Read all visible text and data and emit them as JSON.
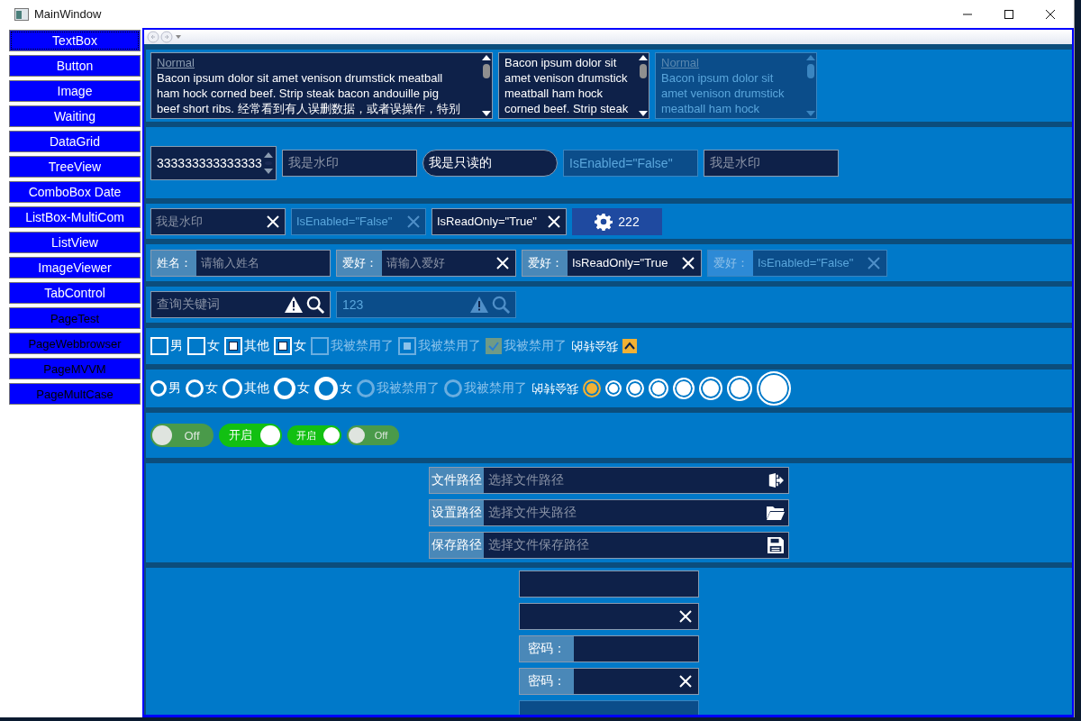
{
  "window": {
    "title": "MainWindow"
  },
  "nav_buttons": [
    {
      "label": "TextBox",
      "kind": "nav"
    },
    {
      "label": "Button",
      "kind": "nav"
    },
    {
      "label": "Image",
      "kind": "nav"
    },
    {
      "label": "Waiting",
      "kind": "nav"
    },
    {
      "label": "DataGrid",
      "kind": "nav"
    },
    {
      "label": "TreeView",
      "kind": "nav"
    },
    {
      "label": "ComboBox Date",
      "kind": "nav"
    },
    {
      "label": "ListBox-MultiCom",
      "kind": "nav"
    },
    {
      "label": "ListView",
      "kind": "nav"
    },
    {
      "label": "ImageViewer",
      "kind": "nav"
    },
    {
      "label": "TabControl",
      "kind": "nav"
    },
    {
      "label": "PageTest",
      "kind": "page"
    },
    {
      "label": "PageWebbrowser",
      "kind": "page"
    },
    {
      "label": "PageMVVM",
      "kind": "page"
    },
    {
      "label": "PageMultCase",
      "kind": "page"
    }
  ],
  "text_areas": [
    {
      "header": "Normal",
      "lines": [
        "Bacon ipsum dolor sit amet venison drumstick meatball",
        "ham hock corned beef. Strip steak bacon andouille pig",
        "beef short ribs. 经常看到有人误删数据，或者误操作，特别"
      ],
      "disabled": false
    },
    {
      "lines": [
        "Bacon ipsum dolor sit",
        "amet venison drumstick",
        "meatball ham hock",
        "corned beef. Strip steak"
      ],
      "disabled": false
    },
    {
      "header": "Normal",
      "lines": [
        "Bacon ipsum dolor sit",
        "amet venison drumstick",
        "meatball ham hock"
      ],
      "disabled": true
    }
  ],
  "input_row": [
    {
      "kind": "numeric",
      "value": "333333333333333",
      "disabled": false
    },
    {
      "kind": "text",
      "placeholder": "我是水印",
      "disabled": false
    },
    {
      "kind": "rounded",
      "value": "我是只读的",
      "disabled": false
    },
    {
      "kind": "text",
      "value": "IsEnabled=\"False\"",
      "disabled": true
    },
    {
      "kind": "text",
      "placeholder": "我是水印",
      "disabled": false
    }
  ],
  "clear_row": [
    {
      "placeholder": "我是水印",
      "disabled": false
    },
    {
      "value": "IsEnabled=\"False\"",
      "disabled": true
    },
    {
      "value": "IsReadOnly=\"True\"",
      "disabled": false
    }
  ],
  "gear_button": {
    "label": "222"
  },
  "labeled_row": [
    {
      "label": "姓名：",
      "placeholder": "请输入姓名",
      "clearable": false,
      "disabled": false
    },
    {
      "label": "爱好：",
      "placeholder": "请输入爱好",
      "clearable": true,
      "disabled": false
    },
    {
      "label": "爱好：",
      "value": "IsReadOnly=\"True",
      "clearable": true,
      "disabled": false
    },
    {
      "label": "爱好：",
      "value": "IsEnabled=\"False\"",
      "clearable": true,
      "disabled": true
    }
  ],
  "search_row": [
    {
      "placeholder": "查询关键词",
      "disabled": false
    },
    {
      "value": "123",
      "disabled": true
    }
  ],
  "checkboxes": [
    {
      "kind": "box",
      "label": "男",
      "checked": false,
      "disabled": false
    },
    {
      "kind": "box",
      "label": "女",
      "checked": false,
      "disabled": false
    },
    {
      "kind": "box",
      "label": "其他",
      "checked": true,
      "disabled": false
    },
    {
      "kind": "box",
      "label": "女",
      "checked": true,
      "disabled": false
    },
    {
      "kind": "box",
      "label": "我被禁用了",
      "checked": false,
      "disabled": true
    },
    {
      "kind": "box",
      "label": "我被禁用了",
      "checked": true,
      "disabled": true
    },
    {
      "kind": "tick",
      "label": "我被禁用了",
      "checked": true,
      "disabled": true
    },
    {
      "kind": "flip",
      "label": "我会转的",
      "checked": true
    }
  ],
  "radios": [
    {
      "kind": "ring",
      "label": "男",
      "selected": false,
      "disabled": false
    },
    {
      "kind": "ring",
      "label": "女",
      "selected": false,
      "disabled": false
    },
    {
      "kind": "ring",
      "label": "其他",
      "selected": false,
      "disabled": false
    },
    {
      "kind": "ring",
      "label": "女",
      "selected": false,
      "disabled": false
    },
    {
      "kind": "ring",
      "label": "女",
      "selected": false,
      "disabled": false
    },
    {
      "kind": "ring",
      "label": "我被禁用了",
      "selected": false,
      "disabled": true
    },
    {
      "kind": "ring",
      "label": "我被禁用了",
      "selected": false,
      "disabled": true
    },
    {
      "kind": "flip",
      "label": "我会转的"
    },
    {
      "kind": "accent",
      "selected": true,
      "disabled": false
    },
    {
      "kind": "ring",
      "selected": true,
      "disabled": false
    },
    {
      "kind": "ring",
      "selected": true,
      "disabled": false
    },
    {
      "kind": "ring",
      "selected": true,
      "disabled": false
    },
    {
      "kind": "ring",
      "selected": true,
      "disabled": false
    },
    {
      "kind": "ring",
      "selected": true,
      "disabled": false
    },
    {
      "kind": "ring",
      "selected": true,
      "disabled": false
    },
    {
      "kind": "ring",
      "selected": true,
      "disabled": false
    }
  ],
  "toggles": [
    {
      "label": "Off",
      "on": false
    },
    {
      "label": "开启",
      "on": true
    },
    {
      "label": "开启",
      "on": true
    },
    {
      "label": "Off",
      "on": false
    }
  ],
  "path_fields": [
    {
      "kind": "file",
      "label": "文件路径",
      "placeholder": "选择文件路径"
    },
    {
      "kind": "folder",
      "label": "设置路径",
      "placeholder": "选择文件夹路径"
    },
    {
      "kind": "save",
      "label": "保存路径",
      "placeholder": "选择文件保存路径"
    }
  ],
  "password_fields": [
    {
      "clearable": false,
      "disabled": false
    },
    {
      "clearable": true,
      "disabled": false
    },
    {
      "label": "密码：",
      "clearable": false,
      "disabled": false
    },
    {
      "label": "密码：",
      "clearable": true,
      "disabled": false
    },
    {
      "clearable": false,
      "disabled": true
    }
  ]
}
